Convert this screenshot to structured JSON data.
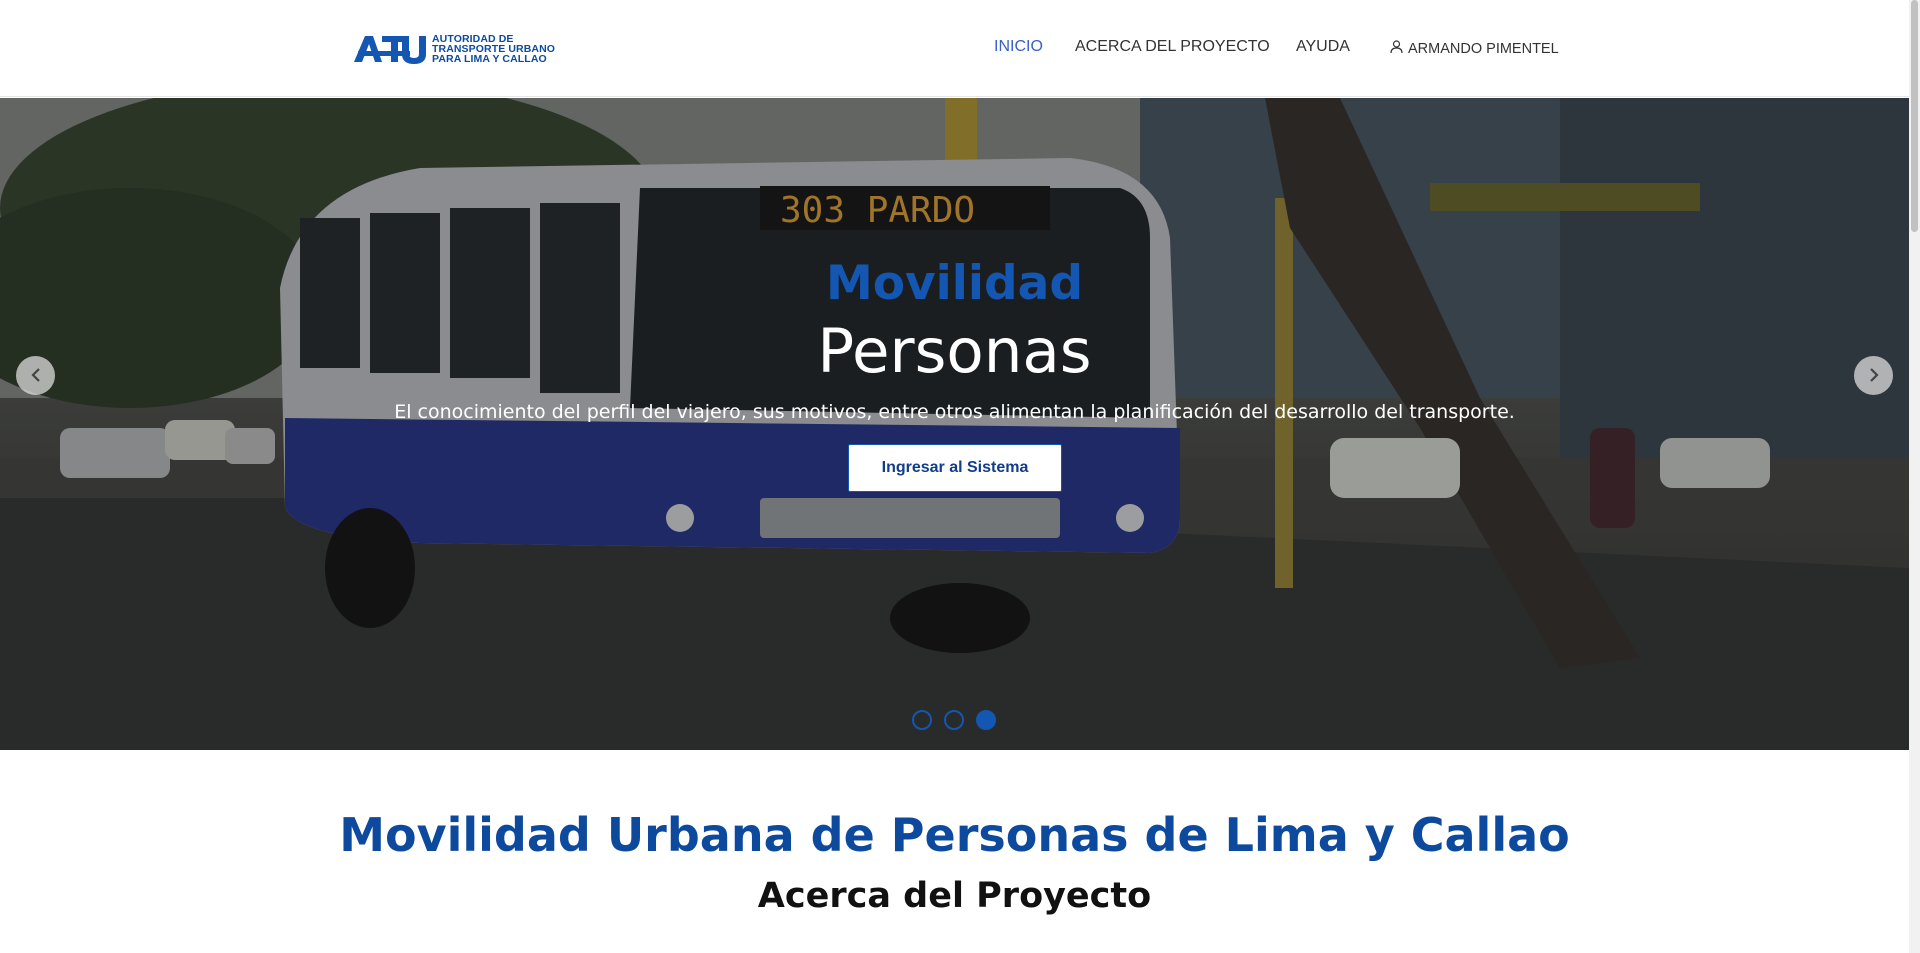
{
  "header": {
    "logo": {
      "mark": "ATU",
      "lines": [
        "AUTORIDAD DE",
        "TRANSPORTE URBANO",
        "PARA LIMA Y CALLAO"
      ]
    },
    "nav": [
      {
        "label": "INICIO",
        "active": true
      },
      {
        "label": "ACERCA DEL PROYECTO",
        "active": false
      },
      {
        "label": "AYUDA",
        "active": false
      }
    ],
    "user": {
      "icon": "user-icon",
      "label": "ARMANDO PIMENTEL"
    }
  },
  "hero": {
    "bus_display": "303 PARDO",
    "kicker": "Movilidad",
    "title": "Personas",
    "description": "El conocimiento del perfil del viajero, sus motivos, entre otros alimentan la planificación del desarrollo del transporte.",
    "button": "Ingresar al Sistema",
    "prev_icon": "chevron-left-icon",
    "next_icon": "chevron-right-icon",
    "slides_total": 3,
    "active_slide": 3
  },
  "section": {
    "title": "Movilidad Urbana de Personas de Lima y Callao",
    "subtitle": "Acerca del Proyecto"
  },
  "colors": {
    "brand_blue": "#1357b3",
    "nav_active": "#3a5fcd",
    "title_blue": "#0d4a9e"
  }
}
